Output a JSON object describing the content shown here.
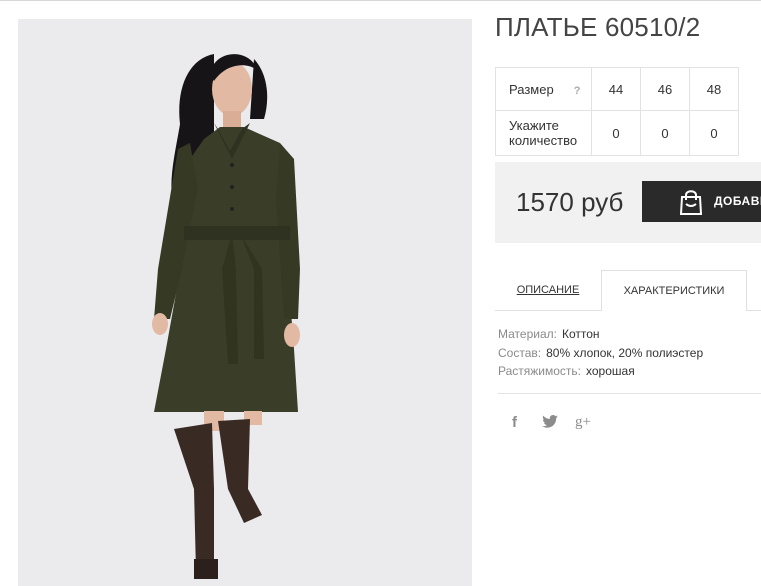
{
  "product": {
    "title": "ПЛАТЬЕ 60510/2",
    "image_alt": "Платье 60510/2",
    "photo_background": "#ebebee"
  },
  "size_table": {
    "size_label": "Размер",
    "help_mark": "?",
    "sizes": [
      "44",
      "46",
      "48"
    ],
    "qty_label": "Укажите количество",
    "quantities": [
      "0",
      "0",
      "0"
    ]
  },
  "purchase": {
    "price": "1570 руб",
    "add_label": "ДОБАВИТЬ В КОРЗИНУ",
    "button_color": "#2a2a2a",
    "bar_color": "#f1f1f1"
  },
  "tabs": [
    {
      "label": "Описание",
      "active": false
    },
    {
      "label": "Характеристики",
      "active": true
    }
  ],
  "specs": [
    {
      "key": "Материал:",
      "value": "Коттон"
    },
    {
      "key": "Состав:",
      "value": "80% хлопок, 20% полиэстер"
    },
    {
      "key": "Растяжимость:",
      "value": "хорошая"
    }
  ],
  "social": [
    {
      "icon": "facebook-icon",
      "glyph": "f"
    },
    {
      "icon": "twitter-icon",
      "glyph": "🐦"
    },
    {
      "icon": "google-plus-icon",
      "glyph": "g+"
    }
  ]
}
